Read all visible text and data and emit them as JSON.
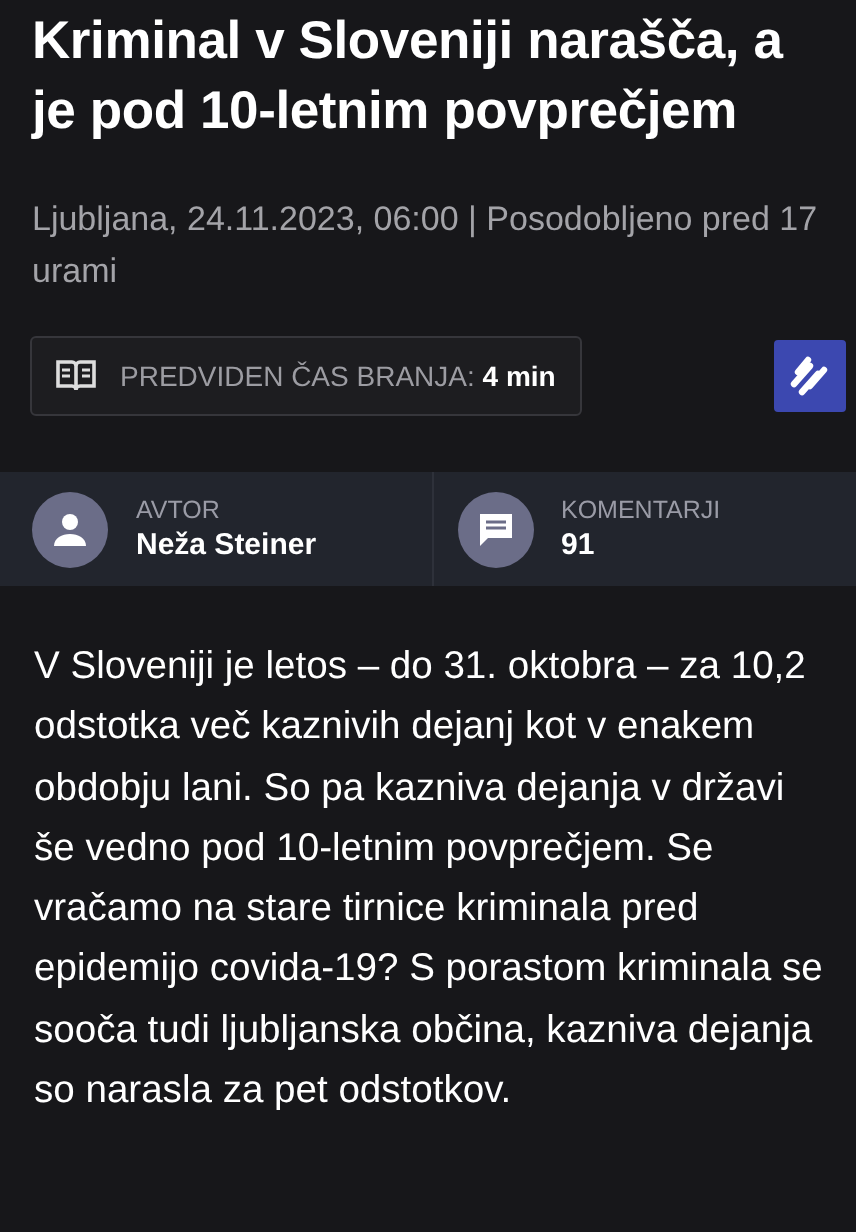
{
  "article": {
    "title": "Kriminal v Sloveniji narašča, a je pod 10-letnim povprečjem",
    "dateline": "Ljubljana, 24.11.2023, 06:00 | Posodobljeno pred 17 urami",
    "reading_time": {
      "label": "PREDVIDEN ČAS BRANJA:",
      "value": "4 min"
    },
    "author": {
      "label": "AVTOR",
      "name": "Neža Steiner"
    },
    "comments": {
      "label": "KOMENTARJI",
      "count": "91"
    },
    "lead": "V Sloveniji je letos – do 31. oktobra – za 10,2 odstotka več kaznivih dejanj kot v enakem obdobju lani. So pa kazniva dejanja v državi še vedno pod 10-letnim povprečjem. Se vračamo na stare tirnice kriminala pred epidemijo covida-19? S porastom kriminala se sooča tudi ljubljanska občina, kazniva dejanja so narasla za pet odstotkov."
  }
}
